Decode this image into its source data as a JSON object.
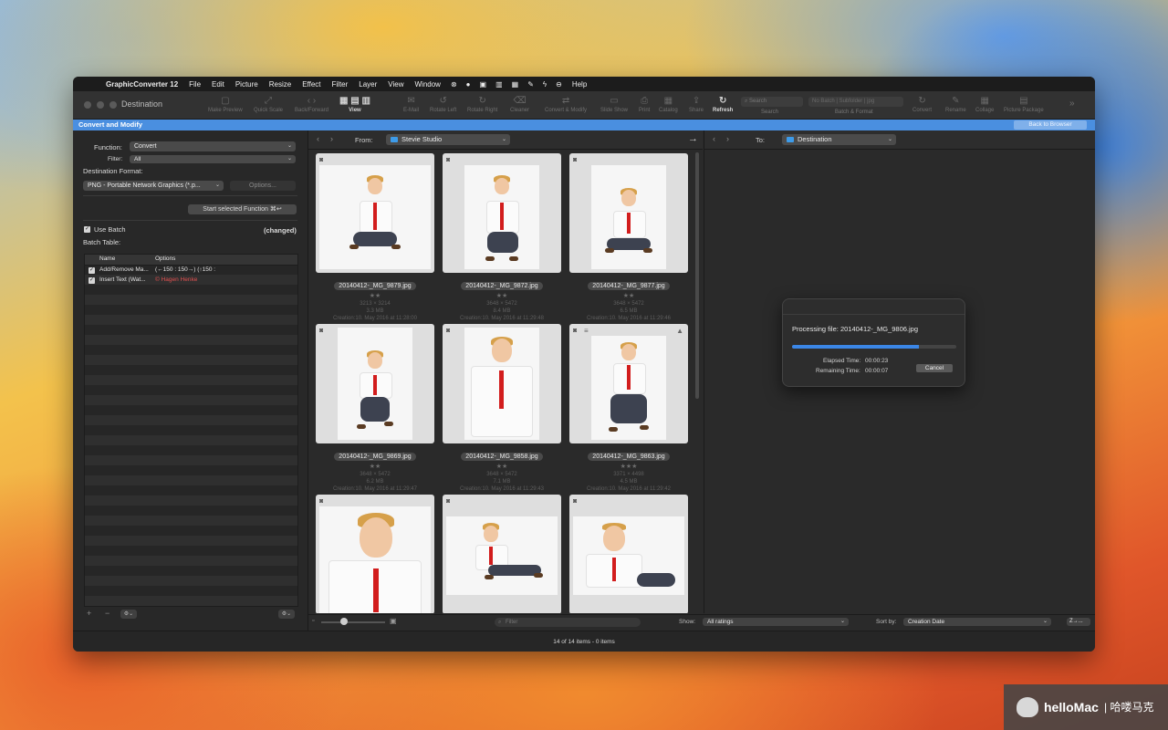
{
  "menubar": {
    "app": "GraphicConverter 12",
    "items": [
      "File",
      "Edit",
      "Picture",
      "Resize",
      "Effect",
      "Filter",
      "Layer",
      "View",
      "Window",
      "Help"
    ]
  },
  "toolbar": {
    "window_title": "Destination",
    "buttons": [
      "Make Preview",
      "Quick Scale",
      "Back/Forward",
      "View",
      "E-Mail",
      "Rotate Left",
      "Rotate Right",
      "Cleaner",
      "Convert & Modify",
      "Slide Show",
      "Print",
      "Catalog",
      "Share",
      "Refresh"
    ],
    "search_placeholder": "Search",
    "search_label": "Search",
    "batch_value": "No Batch | Subfolder | jpg",
    "batch_label": "Batch & Format",
    "right_buttons": [
      "Convert",
      "Rename",
      "Collage",
      "Picture Package"
    ]
  },
  "bluebar": {
    "title": "Convert and Modify",
    "back": "Back to Browser"
  },
  "left": {
    "function_label": "Function:",
    "function_value": "Convert",
    "filter_label": "Filter:",
    "filter_value": "All",
    "dest_format_label": "Destination Format:",
    "dest_format_value": "PNG - Portable Network Graphics (*.p...",
    "options_button": "Options...",
    "start_button": "Start selected Function  ⌘↩",
    "use_batch": "Use Batch",
    "changed": "(changed)",
    "batch_table_label": "Batch Table:",
    "batch_cols": [
      "Name",
      "Options"
    ],
    "batch_rows": [
      {
        "name": "Add/Remove Ma...",
        "options": "(←150 : 150→) (↑150 :",
        "red": false
      },
      {
        "name": "Insert Text (Wat...",
        "options": "© Hagen Henke",
        "red": true
      }
    ],
    "add": "+",
    "remove": "−"
  },
  "browser": {
    "from_label": "From:",
    "from_value": "Stevie Studio",
    "to_label": "To:",
    "to_value": "Destination",
    "thumbs": [
      {
        "name": "20140412-_MG_9879.jpg",
        "stars": "★★",
        "dims": "3213 × 3214",
        "size": "3.3 MB",
        "created": "Creation:10. May 2016 at 11:28:00"
      },
      {
        "name": "20140412-_MG_9872.jpg",
        "stars": "★★",
        "dims": "3648 × 5472",
        "size": "8.4 MB",
        "created": "Creation:10. May 2016 at 11:29:48"
      },
      {
        "name": "20140412-_MG_9877.jpg",
        "stars": "★★",
        "dims": "3648 × 5472",
        "size": "6.5 MB",
        "created": "Creation:10. May 2016 at 11:29:46"
      },
      {
        "name": "20140412-_MG_9869.jpg",
        "stars": "★★",
        "dims": "3648 × 5472",
        "size": "6.2 MB",
        "created": "Creation:10. May 2016 at 11:29:47"
      },
      {
        "name": "20140412-_MG_9858.jpg",
        "stars": "★★",
        "dims": "3648 × 5472",
        "size": "7.1 MB",
        "created": "Creation:10. May 2016 at 11:29:43"
      },
      {
        "name": "20140412-_MG_9863.jpg",
        "stars": "★★★",
        "dims": "3371 × 4498",
        "size": "4.5 MB",
        "created": "Creation:10. May 2016 at 11:29:42"
      },
      {
        "name": "",
        "stars": "",
        "dims": "",
        "size": "",
        "created": ""
      },
      {
        "name": "",
        "stars": "",
        "dims": "",
        "size": "",
        "created": ""
      },
      {
        "name": "",
        "stars": "",
        "dims": "",
        "size": "",
        "created": ""
      }
    ],
    "filter_placeholder": "Filter",
    "show_label": "Show:",
    "show_value": "All ratings",
    "sort_label": "Sort by:",
    "sort_value": "Creation Date",
    "sort_dir": "Z→..."
  },
  "dialog": {
    "processing": "Processing file: 20140412-_MG_9806.jpg",
    "progress": 0.77,
    "elapsed_label": "Elapsed Time:",
    "elapsed": "00:00:23",
    "remaining_label": "Remaining Time:",
    "remaining": "00:00:07",
    "cancel": "Cancel"
  },
  "status": "14 of 14 items - 0 items",
  "watermark": {
    "brand": "helloMac",
    "cn": "| 哈喽马克"
  },
  "colors": {
    "accent": "#4a8fe0",
    "progress": "#3b86e6",
    "tie": "#d21d1d"
  }
}
